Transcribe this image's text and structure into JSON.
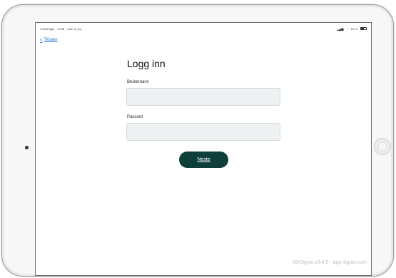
{
  "status_bar": {
    "left": [
      "◂ TestFlight",
      "10:48",
      "man. 8. jun."
    ],
    "signal": "▂▄▆",
    "wifi": "◔",
    "battery_percent": "61 %",
    "battery_level": 0.61
  },
  "nav": {
    "back_label": "Tilbake",
    "back_icon": "chevron-left-icon"
  },
  "login": {
    "title": "Logg inn",
    "username_label": "Brukernavn",
    "username_value": "",
    "password_label": "Passord",
    "password_value": "",
    "next_button": "Neste"
  },
  "footer": {
    "version": "MyDignio v3.4.0 - app.dignio.com"
  },
  "colors": {
    "button_bg": "#0f3f3a",
    "link": "#2a7de1",
    "field_bg": "#eef1f1"
  }
}
